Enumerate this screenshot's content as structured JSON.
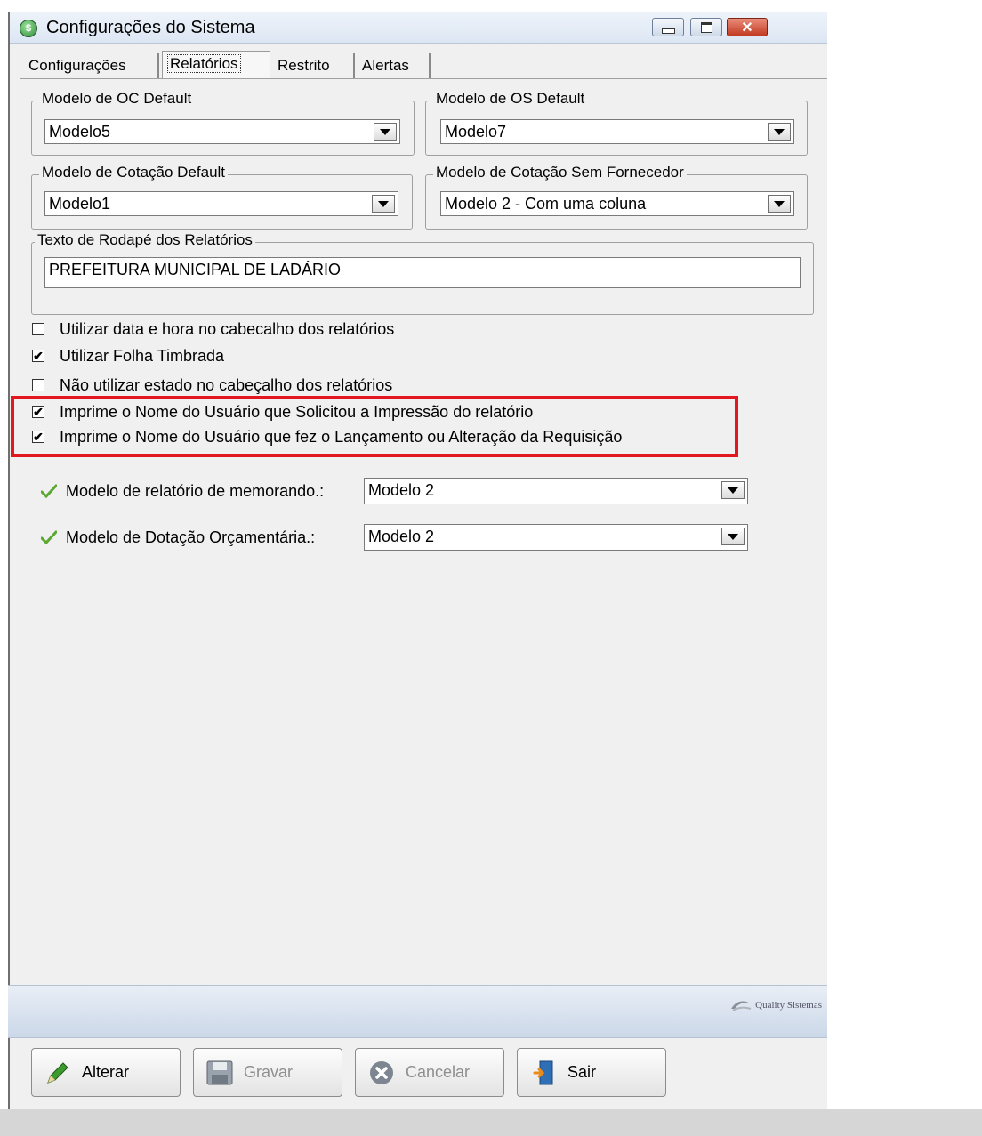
{
  "window": {
    "title": "Configurações do Sistema",
    "controls": {
      "minimize": "minimize",
      "maximize": "maximize",
      "close": "✕"
    }
  },
  "tabs": [
    {
      "label": "Configurações",
      "active": false
    },
    {
      "label": "Relatórios",
      "active": true
    },
    {
      "label": "Restrito",
      "active": false
    },
    {
      "label": "Alertas",
      "active": false
    }
  ],
  "groups": {
    "oc_model": {
      "label": "Modelo de OC Default",
      "value": "Modelo5"
    },
    "os_model": {
      "label": "Modelo de OS Default",
      "value": "Modelo7"
    },
    "quote_model": {
      "label": "Modelo de Cotação Default",
      "value": "Modelo1"
    },
    "quote_no_supplier_model": {
      "label": "Modelo de Cotação Sem Fornecedor",
      "value": "Modelo 2 - Com uma coluna"
    },
    "footer_text": {
      "label": "Texto de  Rodapé dos Relatórios",
      "value": "PREFEITURA MUNICIPAL DE LADÁRIO"
    }
  },
  "checkboxes": [
    {
      "label": "Utilizar data e hora no cabecalho dos relatórios",
      "checked": false
    },
    {
      "label": "Utilizar Folha Timbrada",
      "checked": true
    },
    {
      "label": "Não utilizar estado no cabeçalho dos relatórios",
      "checked": false
    },
    {
      "label": "Imprime o Nome do Usuário que Solicitou a Impressão do relatório",
      "checked": true
    },
    {
      "label": "Imprime o Nome do Usuário que fez o Lançamento ou Alteração da Requisição",
      "checked": true
    }
  ],
  "check_mark": "✔",
  "options": {
    "memo": {
      "label": "Modelo de relatório de memorando.:",
      "value": "Modelo 2"
    },
    "dotacao": {
      "label": "Modelo de  Dotação Orçamentária.:",
      "value": "Modelo 2"
    }
  },
  "brand": "Quality Sistemas",
  "buttons": {
    "alterar": "Alterar",
    "gravar": "Gravar",
    "cancelar": "Cancelar",
    "sair": "Sair"
  },
  "colors": {
    "highlight": "#e2171f",
    "accent_green": "#5aa832"
  }
}
